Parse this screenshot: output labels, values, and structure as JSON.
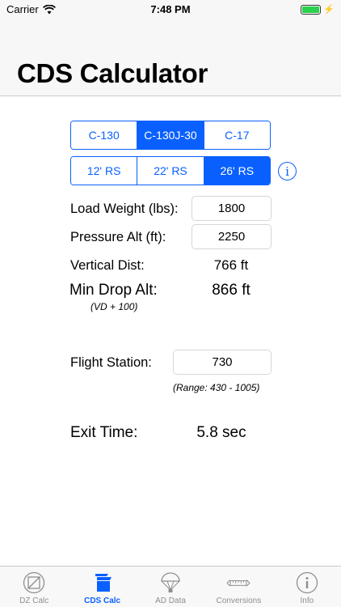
{
  "status": {
    "carrier": "Carrier",
    "time": "7:48 PM",
    "battery_level": 1.0
  },
  "nav": {
    "title": "CDS Calculator"
  },
  "aircraft_options": [
    "C-130",
    "C-130J-30",
    "C-17"
  ],
  "aircraft_selected": "C-130J-30",
  "rs_options": [
    "12' RS",
    "22' RS",
    "26' RS"
  ],
  "rs_selected": "26' RS",
  "form": {
    "load_weight_label": "Load Weight (lbs):",
    "load_weight_value": "1800",
    "pressure_alt_label": "Pressure Alt (ft):",
    "pressure_alt_value": "2250",
    "vertical_dist_label": "Vertical Dist:",
    "vertical_dist_value": "766 ft",
    "min_drop_alt_label": "Min Drop Alt:",
    "min_drop_alt_value": "866 ft",
    "min_drop_alt_note": "(VD + 100)",
    "flight_station_label": "Flight Station:",
    "flight_station_value": "730",
    "flight_station_range": "(Range: 430 - 1005)",
    "exit_time_label": "Exit Time:",
    "exit_time_value": "5.8 sec"
  },
  "tabs": [
    {
      "label": "DZ Calc",
      "icon": "dz-calc-icon"
    },
    {
      "label": "CDS Calc",
      "icon": "cds-calc-icon"
    },
    {
      "label": "AD Data",
      "icon": "parachute-icon"
    },
    {
      "label": "Conversions",
      "icon": "ruler-arrows-icon"
    },
    {
      "label": "Info",
      "icon": "info-icon"
    }
  ],
  "active_tab": "CDS Calc",
  "colors": {
    "accent": "#0a60ff",
    "inactive_tab": "#8e8e93",
    "battery": "#2bd14d"
  }
}
